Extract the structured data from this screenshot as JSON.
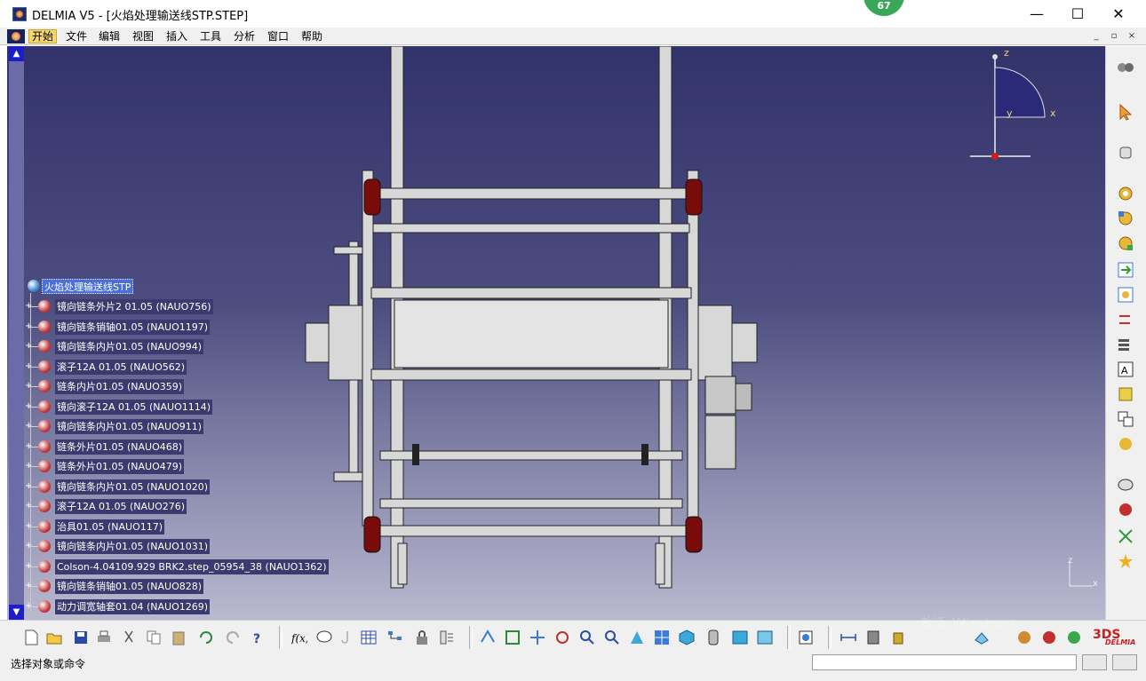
{
  "window": {
    "title": "DELMIA V5 - [火焰处理输送线STP.STEP]",
    "notification_count": "67",
    "controls": {
      "minimize": "—",
      "maximize": "☐",
      "close": "✕"
    }
  },
  "menu": {
    "items": [
      "开始",
      "文件",
      "编辑",
      "视图",
      "插入",
      "工具",
      "分析",
      "窗口",
      "帮助"
    ],
    "active": "开始",
    "mdi_controls": [
      "_",
      "▫",
      "×"
    ]
  },
  "tree": {
    "root": "火焰处理输送线STP",
    "items": [
      "镜向链条外片2 01.05 (NAUO756)",
      "镜向链条销轴01.05 (NAUO1197)",
      "镜向链条内片01.05 (NAUO994)",
      "滚子12A 01.05 (NAUO562)",
      "链条内片01.05 (NAUO359)",
      "镜向滚子12A 01.05 (NAUO1114)",
      "镜向链条内片01.05 (NAUO911)",
      "链条外片01.05 (NAUO468)",
      "链条外片01.05 (NAUO479)",
      "镜向链条内片01.05 (NAUO1020)",
      "滚子12A 01.05 (NAUO276)",
      "治具01.05 (NAUO117)",
      "镜向链条内片01.05 (NAUO1031)",
      "Colson-4.04109.929 BRK2.step_05954_38 (NAUO1362)",
      "镜向链条销轴01.05 (NAUO828)",
      "动力调宽轴套01.04 (NAUO1269)"
    ],
    "scroll_up": "▲",
    "scroll_down": "▼"
  },
  "compass": {
    "z": "z",
    "x": "x",
    "y": "y"
  },
  "mini_axis": {
    "z": "z",
    "x": "x"
  },
  "status": {
    "prompt": "选择对象或命令",
    "command_value": ""
  },
  "brand": {
    "logo_text": "DELMIA",
    "watermark": "激活 Windows"
  },
  "right_toolbar_icons": [
    "bolts-icon",
    "select-arrow-icon",
    "hand-select-icon",
    "gear-constraint-icon",
    "gear-move-icon",
    "gear-snap-icon",
    "insert-arrow-icon",
    "new-component-icon",
    "replace-icon",
    "reorder-icon",
    "text-annotation-icon",
    "catalog-icon",
    "multi-instance-icon",
    "update-icon",
    "measure-icon",
    "fix-icon",
    "explode-icon",
    "star-icon"
  ],
  "bottom_toolbar_icons": [
    "new-icon",
    "open-icon",
    "save-icon",
    "print-icon",
    "cut-icon",
    "copy-icon",
    "paste-icon",
    "undo-icon",
    "redo-icon",
    "whats-this-icon",
    "formula-icon",
    "comment-icon",
    "hook-icon",
    "table-icon",
    "tree-icon",
    "lock-icon",
    "structure-icon",
    "fly-icon",
    "fit-all-icon",
    "pan-icon",
    "rotate-icon",
    "zoom-in-icon",
    "zoom-out-icon",
    "normal-view-icon",
    "multiview-icon",
    "isometric-icon",
    "shading-icon",
    "hide-show-icon",
    "swap-space-icon",
    "update-icon",
    "measure-between-icon",
    "analyze-icon",
    "clash-icon",
    "section-icon",
    "material-icon",
    "render-icon",
    "delmia-icon"
  ],
  "colors": {
    "viewport_top": "#33336b",
    "viewport_bottom": "#b9b9d0",
    "tree_selection": "#4b6fd8",
    "tree_label_bg": "#3a3a6e",
    "menu_active": "#f5d66a",
    "scrollbar": "#1e1ec8"
  }
}
